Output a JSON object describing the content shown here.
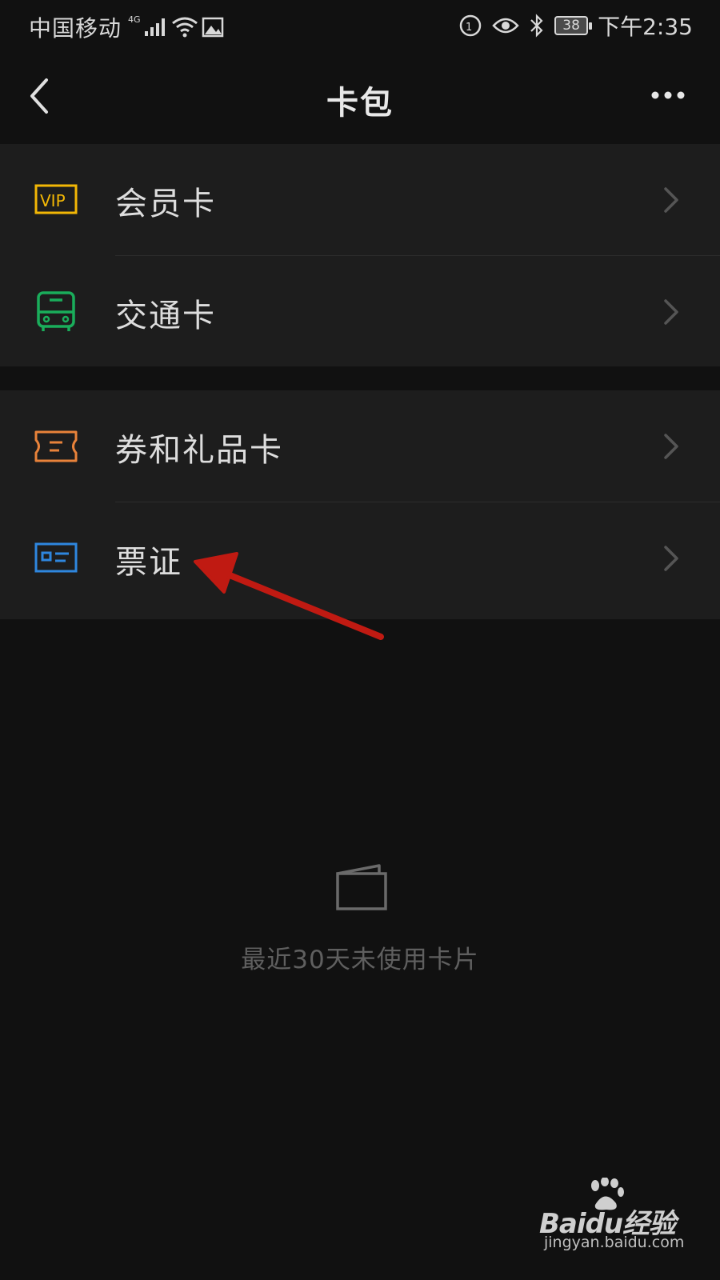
{
  "status_bar": {
    "carrier": "中国移动",
    "network_type": "4G",
    "battery_level": "38",
    "time": "下午2:35"
  },
  "nav": {
    "title": "卡包",
    "back_icon": "back-chevron-icon",
    "more_icon": "more-dots-icon"
  },
  "sections": [
    {
      "items": [
        {
          "label": "会员卡",
          "icon": "vip-card-icon",
          "icon_color": "#F2B705"
        },
        {
          "label": "交通卡",
          "icon": "bus-icon",
          "icon_color": "#1AAD5B"
        }
      ]
    },
    {
      "items": [
        {
          "label": "券和礼品卡",
          "icon": "ticket-icon",
          "icon_color": "#E8823A"
        },
        {
          "label": "票证",
          "icon": "id-card-icon",
          "icon_color": "#2E86DE"
        }
      ]
    }
  ],
  "empty_state": {
    "icon": "wallet-icon",
    "text": "最近30天未使用卡片"
  },
  "annotation": {
    "arrow_color": "#C01A12",
    "target": "票证"
  },
  "watermark": {
    "logo_text": "Baidu经验",
    "url": "jingyan.baidu.com"
  }
}
